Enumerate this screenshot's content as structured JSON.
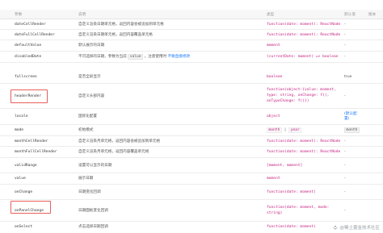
{
  "header": {
    "param": "参数",
    "desc": "说明",
    "type": "类型",
    "default": "默认值",
    "version": "版本"
  },
  "rows": [
    {
      "param": "dateCellRender",
      "desc": "自定义渲染日期单元格，返回内容会被追加到单元格",
      "type": "function(date: moment): ReactNode",
      "default": "-"
    },
    {
      "param": "dateFullCellRender",
      "desc": "自定义渲染日期单元格，返回内容覆盖单元格",
      "type": "function(date: moment): ReactNode",
      "default": "-"
    },
    {
      "param": "defaultValue",
      "desc": "默认展示的日期",
      "type": "moment",
      "default": "-"
    },
    {
      "param": "disabledDate",
      "desc_before": "不可选择的日期，参数为当前",
      "desc_code": "value",
      "desc_mid": "，注意使用时",
      "desc_link": "不要直接修改",
      "type": "(currentDate: moment) => boolean",
      "default": "-"
    },
    {
      "param": "fullscreen",
      "desc": "是否全屏显示",
      "type": "boolean",
      "default": "true"
    },
    {
      "param": "headerRender",
      "desc": "自定义头部内容",
      "type_lines": [
        "function(object:{value: moment,",
        "type: string, onChange: f(),",
        "onTypeChange: f()})"
      ],
      "default": "-"
    },
    {
      "param": "locale",
      "desc": "国际化配置",
      "type": "object",
      "default_link_lines": [
        "(默认配",
        "置)"
      ]
    },
    {
      "param": "mode",
      "desc": "初始模式",
      "type_tags": [
        "month",
        "year"
      ],
      "type_sep": "|",
      "default": "month"
    },
    {
      "param": "monthCellRender",
      "desc": "自定义渲染月单元格，返回内容会被追加到单元格",
      "type": "function(date: moment): ReactNode",
      "default": "-"
    },
    {
      "param": "monthFullCellRender",
      "desc": "自定义渲染月单元格，返回内容覆盖单元格",
      "type": "function(date: moment): ReactNode",
      "default": "-"
    },
    {
      "param": "validRange",
      "desc": "设置可以显示的日期",
      "type": "[moment, moment]",
      "default": "-"
    },
    {
      "param": "value",
      "desc": "展示日期",
      "type": "moment",
      "default": "-"
    },
    {
      "param": "onChange",
      "desc": "日期变化回调",
      "type": "function(date: moment)",
      "default": "-"
    },
    {
      "param": "onPanelChange",
      "desc": "日期面板变化回调",
      "type_lines": [
        "function(date: moment, mode:",
        "string)"
      ],
      "default": "-"
    },
    {
      "param": "onSelect",
      "desc": "点击选择日期回调",
      "type": "function(date: moment)",
      "default": "-"
    }
  ],
  "watermark": "@稀土掘金技术社区"
}
